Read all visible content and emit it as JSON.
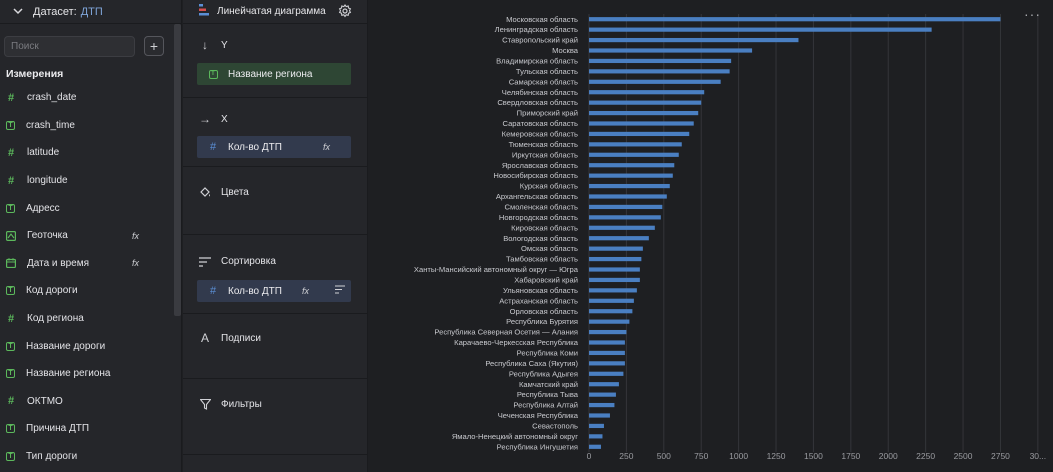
{
  "dataset": {
    "label": "Датасет:",
    "name": "ДТП"
  },
  "search": {
    "placeholder": "Поиск"
  },
  "dimensions_title": "Измерения",
  "fields": [
    {
      "name": "crash_date",
      "type": "number",
      "icon": "number-icon",
      "fx": ""
    },
    {
      "name": "crash_time",
      "type": "string",
      "icon": "string-icon",
      "fx": ""
    },
    {
      "name": "latitude",
      "type": "number",
      "icon": "number-icon",
      "fx": ""
    },
    {
      "name": "longitude",
      "type": "number",
      "icon": "number-icon",
      "fx": ""
    },
    {
      "name": "Адресс",
      "type": "string",
      "icon": "string-icon",
      "fx": ""
    },
    {
      "name": "Геоточка",
      "type": "geo",
      "icon": "geopoint-icon",
      "fx": "fx"
    },
    {
      "name": "Дата и время",
      "type": "date",
      "icon": "calendar-icon",
      "fx": "fx"
    },
    {
      "name": "Код дороги",
      "type": "string",
      "icon": "string-icon",
      "fx": ""
    },
    {
      "name": "Код региона",
      "type": "number",
      "icon": "number-icon",
      "fx": ""
    },
    {
      "name": "Название дороги",
      "type": "string",
      "icon": "string-icon",
      "fx": ""
    },
    {
      "name": "Название региона",
      "type": "string",
      "icon": "string-icon",
      "fx": ""
    },
    {
      "name": "ОКТМО",
      "type": "number",
      "icon": "number-icon",
      "fx": ""
    },
    {
      "name": "Причина ДТП",
      "type": "string",
      "icon": "string-icon",
      "fx": ""
    },
    {
      "name": "Тип дороги",
      "type": "string",
      "icon": "string-icon",
      "fx": ""
    }
  ],
  "wizard": {
    "chart_type": "Линейчатая диаграмма",
    "y": {
      "title": "Y",
      "chip": "Название региона"
    },
    "x": {
      "title": "X",
      "chip": "Кол-во ДТП",
      "fx": "fx"
    },
    "colors": {
      "title": "Цвета"
    },
    "sort": {
      "title": "Сортировка",
      "chip": "Кол-во ДТП",
      "fx": "fx"
    },
    "labels": {
      "title": "Подписи"
    },
    "filters": {
      "title": "Фильтры"
    }
  },
  "colors": {
    "bar": "#4a7fc2",
    "string_field": "#5cb85c",
    "accent_link": "#7fa4d8"
  },
  "chart_data": {
    "type": "bar",
    "orientation": "horizontal",
    "categories": [
      "Московская область",
      "Ленинградская область",
      "Ставропольский край",
      "Москва",
      "Владимирская область",
      "Тульская область",
      "Самарская область",
      "Челябинская область",
      "Свердловская область",
      "Приморский край",
      "Саратовская область",
      "Кемеровская область",
      "Тюменская область",
      "Иркутская область",
      "Ярославская область",
      "Новосибирская область",
      "Курская область",
      "Архангельская область",
      "Смоленская область",
      "Новгородская область",
      "Кировская область",
      "Вологодская область",
      "Омская область",
      "Тамбовская область",
      "Ханты-Мансийский автономный округ — Югра",
      "Хабаровский край",
      "Ульяновская область",
      "Астраханская область",
      "Орловская область",
      "Республика Бурятия",
      "Республика Северная Осетия — Алания",
      "Карачаево-Черкесская Республика",
      "Республика Коми",
      "Республика Саха (Якутия)",
      "Республика Адыгея",
      "Камчатский край",
      "Республика Тыва",
      "Республика Алтай",
      "Чеченская Республика",
      "Севастополь",
      "Ямало-Ненецкий автономный округ",
      "Республика Ингушетия"
    ],
    "values": [
      2750,
      2290,
      1400,
      1090,
      950,
      940,
      880,
      770,
      750,
      730,
      700,
      670,
      620,
      600,
      570,
      560,
      540,
      520,
      490,
      480,
      440,
      400,
      360,
      350,
      340,
      340,
      320,
      300,
      290,
      270,
      250,
      240,
      240,
      240,
      230,
      200,
      180,
      170,
      140,
      100,
      90,
      80
    ],
    "x_ticks": [
      "0",
      "250",
      "500",
      "750",
      "1000",
      "1250",
      "1500",
      "1750",
      "2000",
      "2250",
      "2500",
      "2750",
      "30..."
    ],
    "xlim": [
      0,
      3000
    ],
    "grid": true,
    "legend": "none"
  }
}
